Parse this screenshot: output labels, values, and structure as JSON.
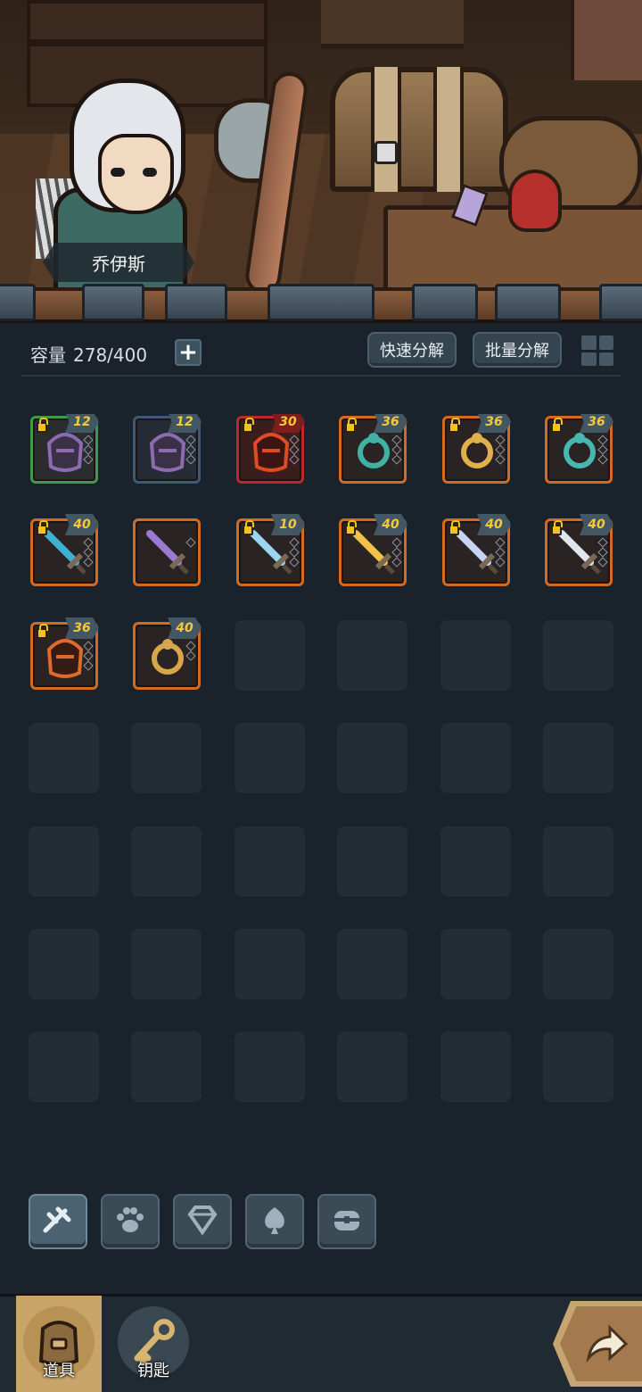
{
  "hero": {
    "name": "乔伊斯"
  },
  "toolbar": {
    "capacity_label": "容量",
    "capacity_value": "278/400",
    "quick_decompose": "快速分解",
    "batch_decompose": "批量分解"
  },
  "inventory": {
    "columns": 6,
    "total_slots": 42,
    "items": [
      {
        "level": "12",
        "quality": "green",
        "locked": true,
        "icon": "dark-helmet-icon",
        "gems": 3
      },
      {
        "level": "12",
        "quality": "blue",
        "locked": false,
        "icon": "dark-helmet-icon",
        "gems": 3
      },
      {
        "level": "30",
        "quality": "red",
        "locked": true,
        "icon": "fire-armor-icon",
        "gems": 3
      },
      {
        "level": "36",
        "quality": "orange",
        "locked": true,
        "icon": "vine-necklace-icon",
        "gems": 3
      },
      {
        "level": "36",
        "quality": "orange",
        "locked": true,
        "icon": "gem-ring-icon",
        "gems": 3
      },
      {
        "level": "36",
        "quality": "orange",
        "locked": true,
        "icon": "flower-amulet-icon",
        "gems": 3
      },
      {
        "level": "40",
        "quality": "orange",
        "locked": true,
        "icon": "feather-staff-icon",
        "gems": 3
      },
      {
        "level": "",
        "quality": "orange",
        "locked": false,
        "icon": "purple-ring-wand-icon",
        "gems": 1
      },
      {
        "level": "10",
        "quality": "orange",
        "locked": true,
        "icon": "ice-sword-icon",
        "gems": 3
      },
      {
        "level": "40",
        "quality": "orange",
        "locked": true,
        "icon": "golden-sword-icon",
        "gems": 3
      },
      {
        "level": "40",
        "quality": "orange",
        "locked": true,
        "icon": "crystal-sword-icon",
        "gems": 3
      },
      {
        "level": "40",
        "quality": "orange",
        "locked": true,
        "icon": "silver-sword-icon",
        "gems": 3
      },
      {
        "level": "36",
        "quality": "orange",
        "locked": true,
        "icon": "fire-claw-icon",
        "gems": 3
      },
      {
        "level": "40",
        "quality": "orange",
        "locked": false,
        "icon": "gold-ring-necklace-icon",
        "gems": 2
      }
    ]
  },
  "categories": [
    {
      "icon": "weapon-category-icon",
      "active": true
    },
    {
      "icon": "paw-category-icon",
      "active": false
    },
    {
      "icon": "gem-category-icon",
      "active": false
    },
    {
      "icon": "spade-category-icon",
      "active": false
    },
    {
      "icon": "chest-category-icon",
      "active": false
    }
  ],
  "bottom_nav": {
    "items_label": "道具",
    "keys_label": "钥匙"
  },
  "colors": {
    "quality_green": "#3f9a48",
    "quality_blue": "#3d5a78",
    "quality_red": "#c0262a",
    "quality_orange": "#d26a22",
    "level_text": "#f6c83a",
    "background": "#1a232b"
  }
}
